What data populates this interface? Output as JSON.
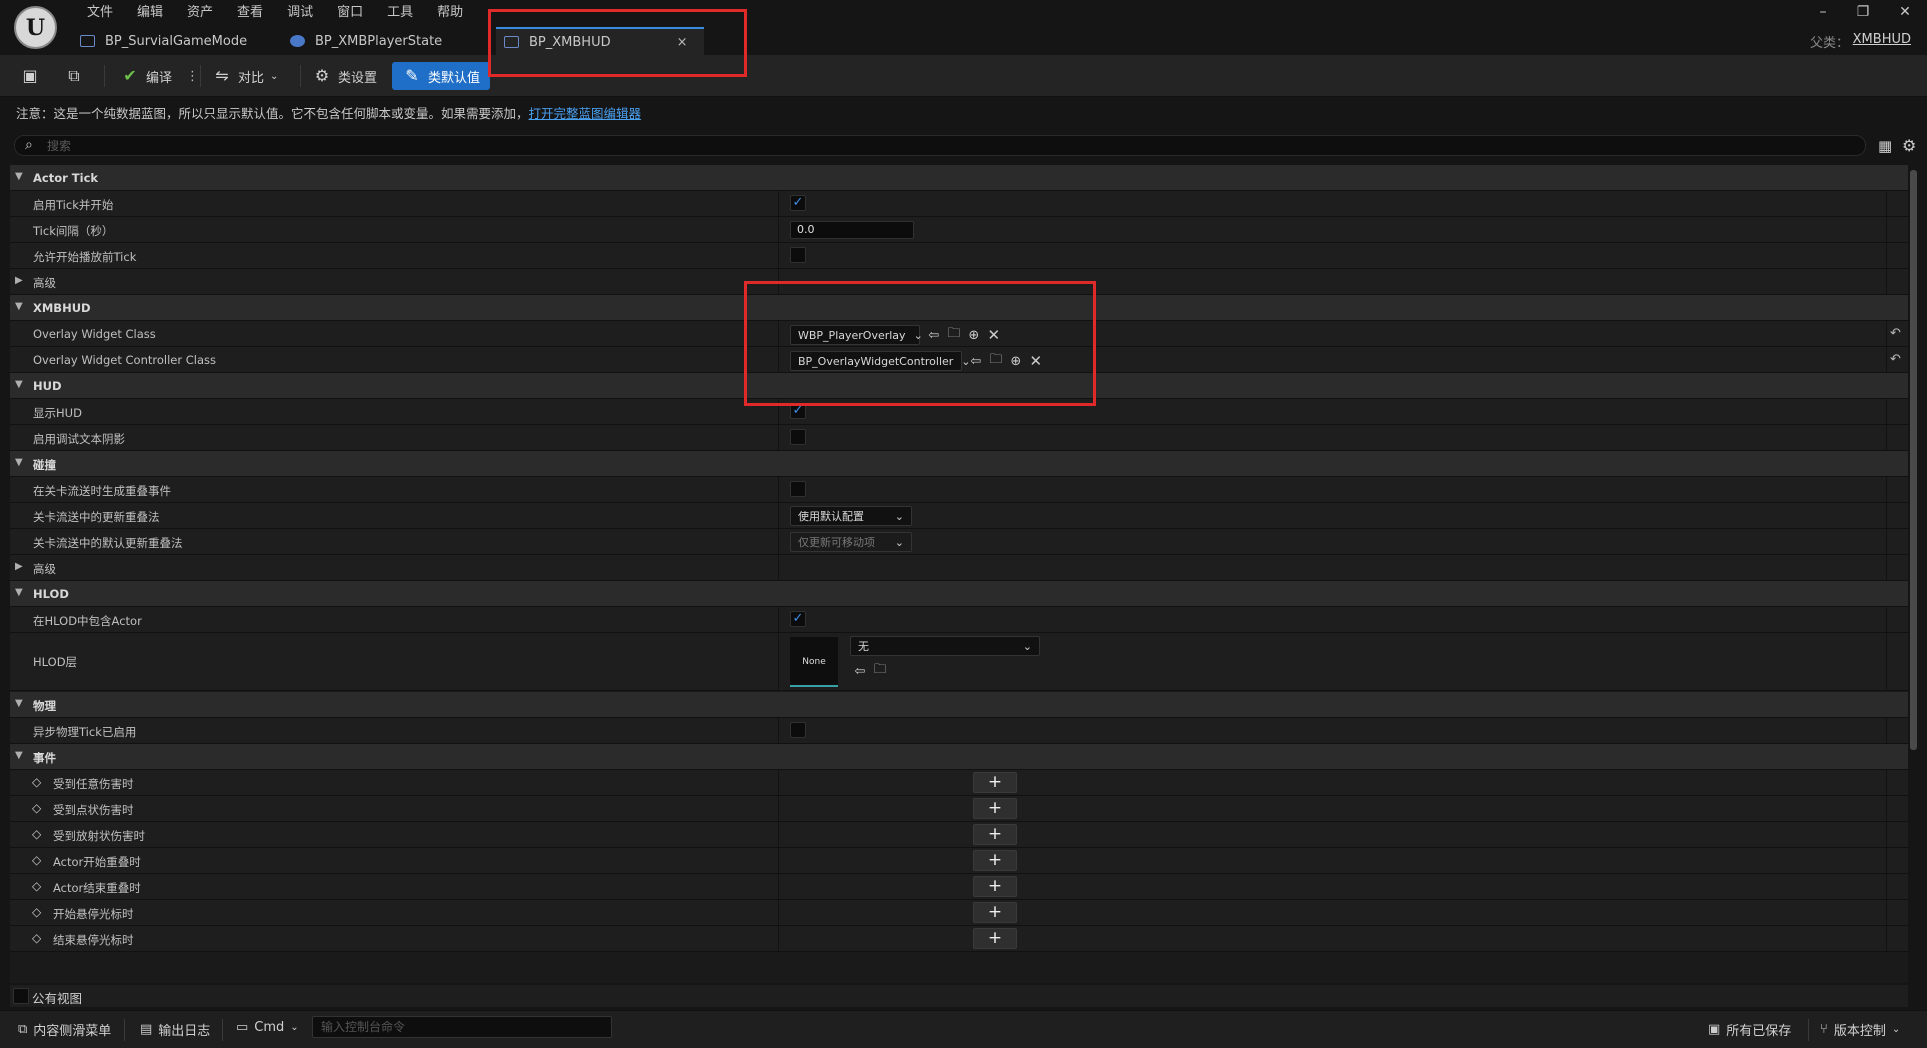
{
  "menu": [
    "文件",
    "编辑",
    "资产",
    "查看",
    "调试",
    "窗口",
    "工具",
    "帮助"
  ],
  "window_controls": {
    "minimize": "–",
    "restore": "❐",
    "close": "✕"
  },
  "parent": {
    "label": "父类：",
    "value": "XMBHUD"
  },
  "tabs": [
    {
      "label": "BP_SurvialGameMode"
    },
    {
      "label": "BP_XMBPlayerState"
    },
    {
      "label": "BP_XMBHUD",
      "close": "×"
    }
  ],
  "toolbar": {
    "compile": "编译",
    "diff": "对比",
    "class_settings": "类设置",
    "class_defaults": "类默认值"
  },
  "notice": {
    "text": "注意：这是一个纯数据蓝图，所以只显示默认值。它不包含任何脚本或变量。如果需要添加，",
    "link": "打开完整蓝图编辑器"
  },
  "search": {
    "placeholder": "搜索"
  },
  "rows": {
    "actor_tick": "Actor Tick",
    "start_with_tick": "启用Tick并开始",
    "tick_interval": "Tick间隔（秒）",
    "tick_interval_value": "0.0",
    "allow_tick_before_play": "允许开始播放前Tick",
    "advanced1": "高级",
    "xmbhud": "XMBHUD",
    "overlay_widget_class": "Overlay Widget Class",
    "overlay_widget_class_value": "WBP_PlayerOverlay",
    "overlay_widget_controller_class": "Overlay Widget Controller Class",
    "overlay_widget_controller_class_value": "BP_OverlayWidgetController",
    "hud": "HUD",
    "show_hud": "显示HUD",
    "debug_text_shadow": "启用调试文本阴影",
    "collision": "碰撞",
    "generate_overlap_events": "在关卡流送时生成重叠事件",
    "update_overlaps_method": "关卡流送中的更新重叠法",
    "update_overlaps_value": "使用默认配置",
    "default_update_overlaps_method": "关卡流送中的默认更新重叠法",
    "default_update_overlaps_value": "仅更新可移动项",
    "advanced2": "高级",
    "hlod": "HLOD",
    "include_in_hlod": "在HLOD中包含Actor",
    "hlod_layer": "HLOD层",
    "hlod_thumb": "None",
    "hlod_layer_value": "无",
    "physics": "物理",
    "async_physics_tick": "异步物理Tick已启用",
    "events": "事件",
    "ev_any_damage": "受到任意伤害时",
    "ev_point_damage": "受到点状伤害时",
    "ev_radial_damage": "受到放射状伤害时",
    "ev_begin_overlap": "Actor开始重叠时",
    "ev_end_overlap": "Actor结束重叠时",
    "ev_begin_cursor": "开始悬停光标时",
    "ev_end_cursor": "结束悬停光标时"
  },
  "public_view": "公有视图",
  "statusbar": {
    "content_drawer": "内容侧滑菜单",
    "output_log": "输出日志",
    "cmd": "Cmd",
    "console_placeholder": "输入控制台命令",
    "all_saved": "所有已保存",
    "source_control": "版本控制"
  },
  "colors": {
    "accent": "#1f6fc8",
    "highlight": "#e02a2a",
    "check": "#3a90e8"
  }
}
